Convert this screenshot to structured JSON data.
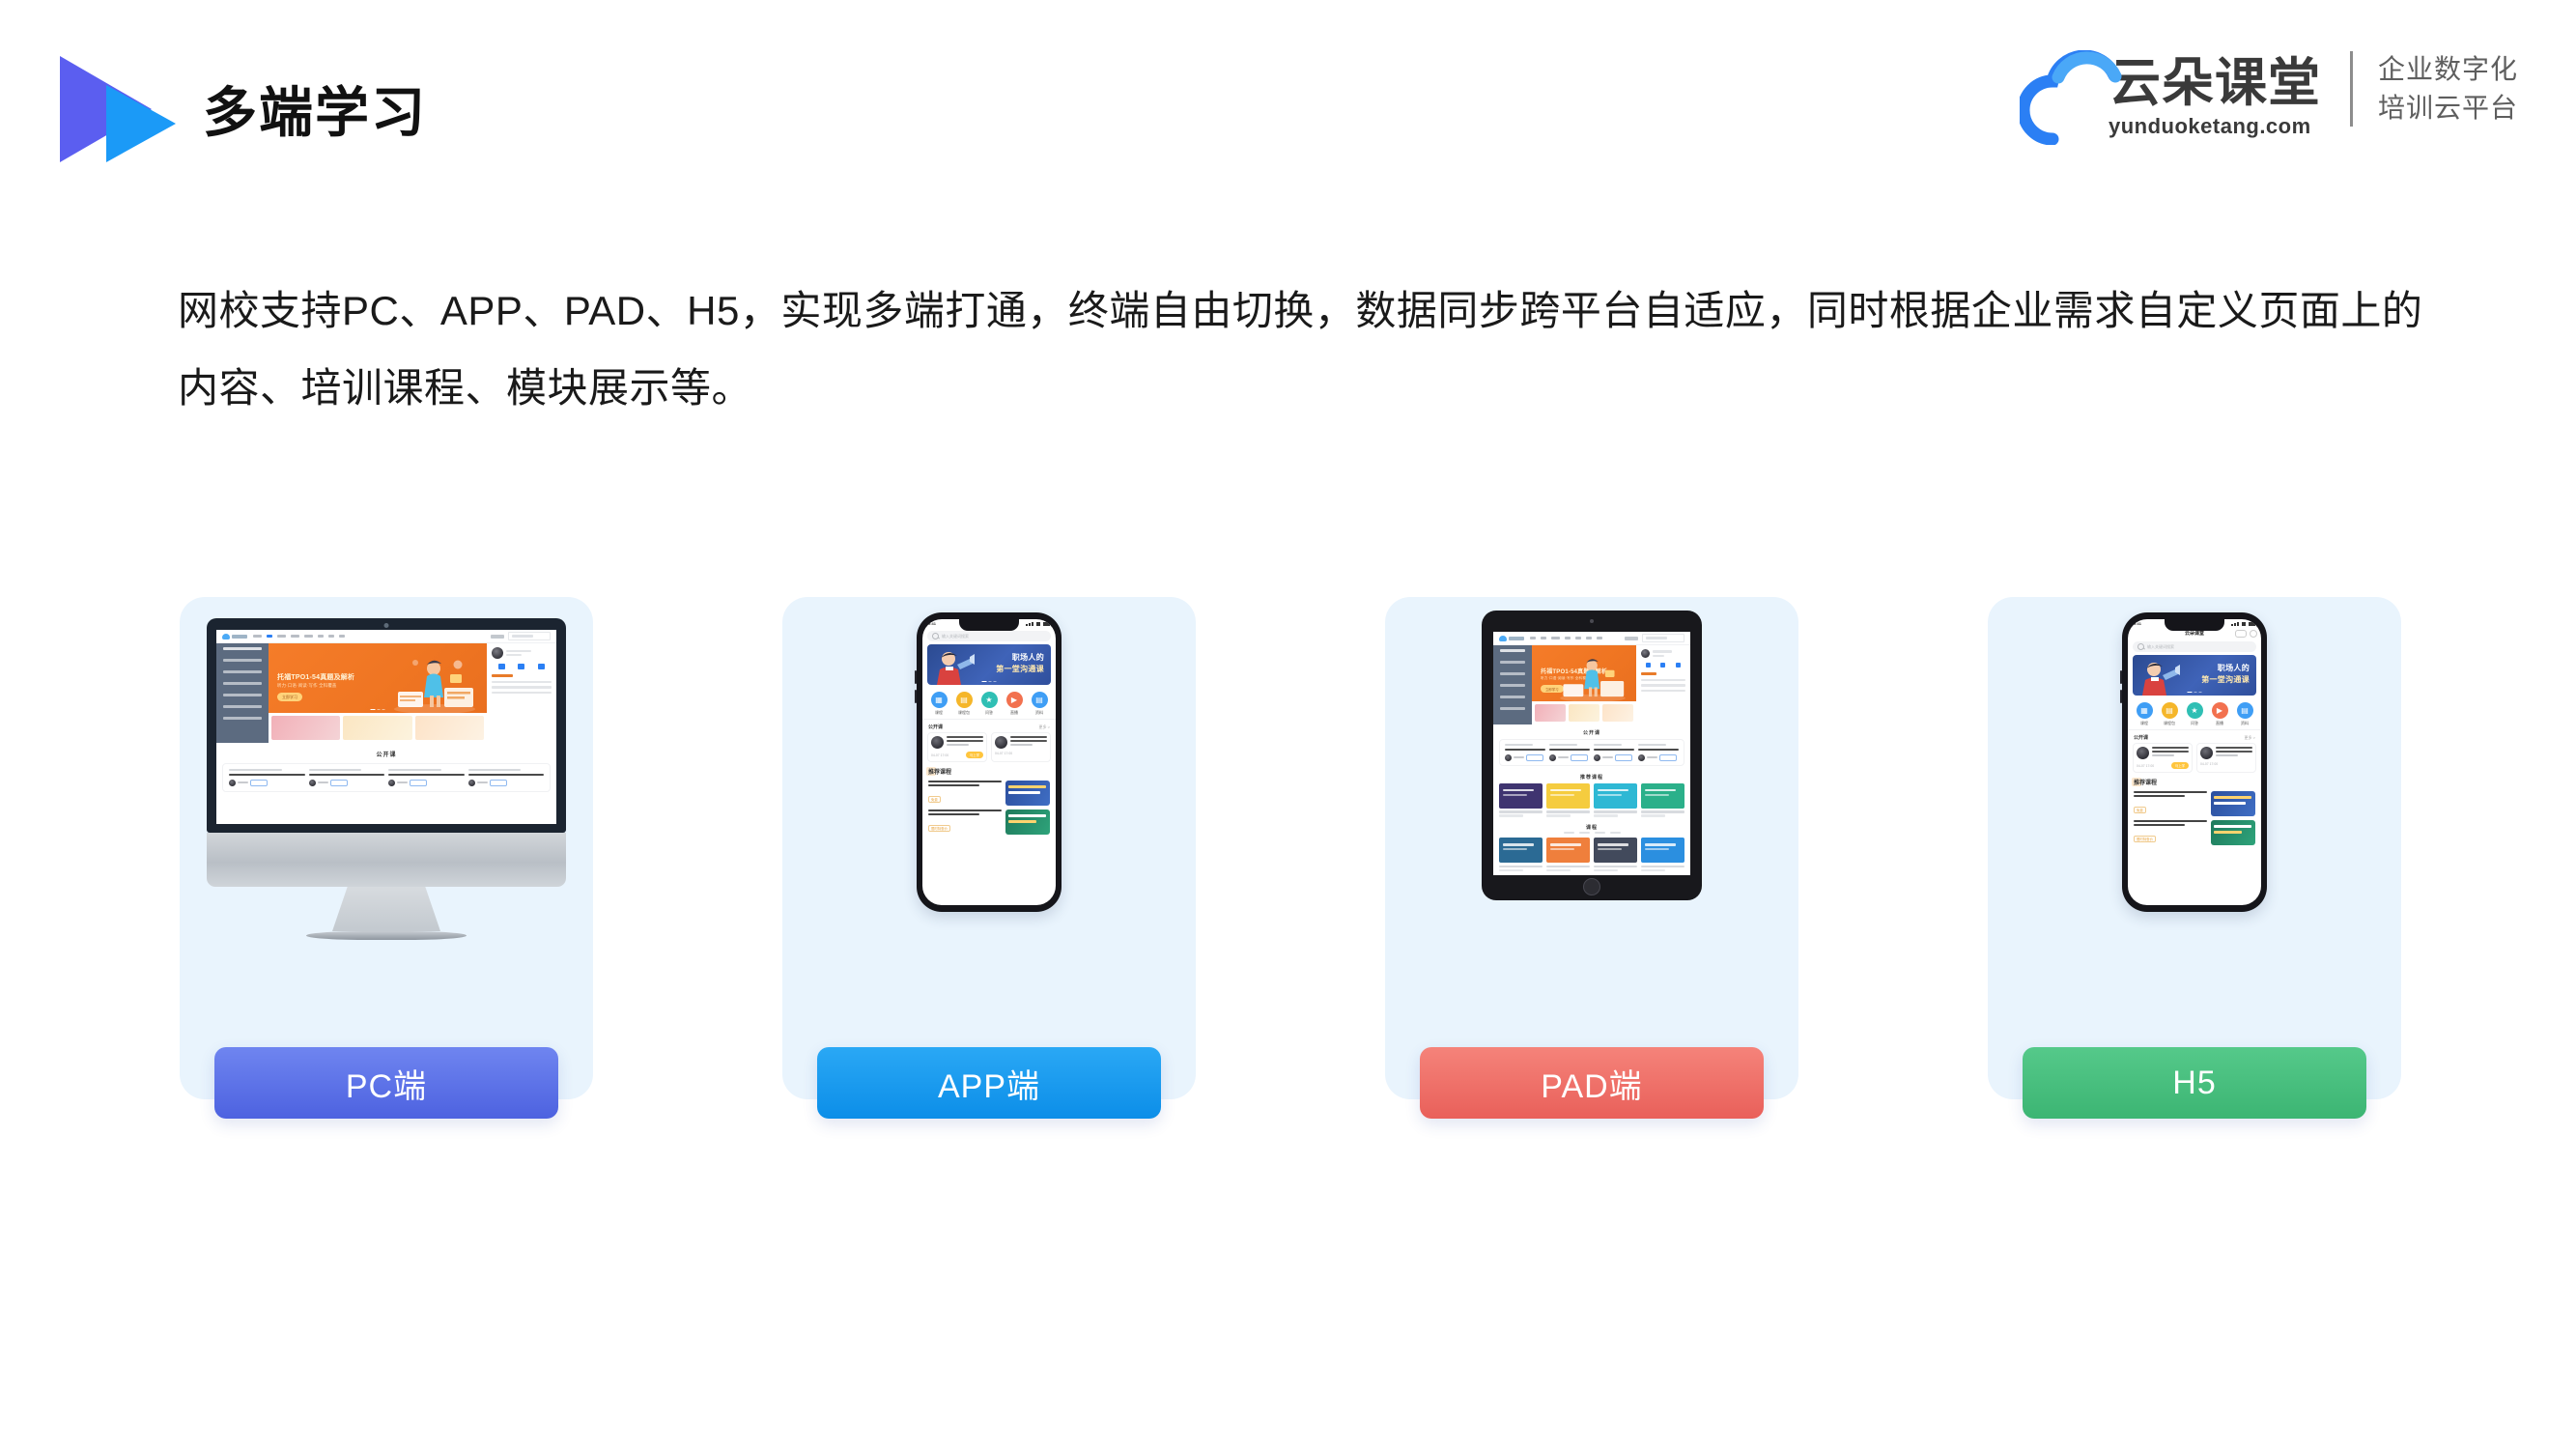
{
  "header": {
    "title": "多端学习",
    "logo_icon": "double-triangle-play-logo",
    "brand": {
      "cloud_icon": "cloud-icon",
      "name_cn": "云朵课堂",
      "url": "yunduoketang.com",
      "tagline_line1": "企业数字化",
      "tagline_line2": "培训云平台"
    }
  },
  "intro": {
    "paragraph": "网校支持PC、APP、PAD、H5，实现多端打通，终端自由切换，数据同步跨平台自适应，同时根据企业需求自定义页面上的内容、培训课程、模块展示等。"
  },
  "cards": [
    {
      "id": "pc",
      "button_label": "PC端",
      "button_color": "#4d62e0",
      "device": "imac-monitor",
      "screen": {
        "hero_title": "托福TPO1-54真题及解析",
        "hero_sub": "听力·口语·阅读·写作 全科覆盖",
        "hero_button": "立即学习",
        "section_title": "公开课"
      }
    },
    {
      "id": "app",
      "button_label": "APP端",
      "button_color": "#0c8ee8",
      "device": "iphone",
      "screen": {
        "status_time": "9:41",
        "search_placeholder": "输入关键词搜索",
        "banner_line1": "职场人的",
        "banner_line2": "第一堂沟通课",
        "categories": [
          "课程",
          "课程包",
          "问答",
          "直播",
          "资料"
        ],
        "category_colors": [
          "#3f9ef5",
          "#f5b62a",
          "#2fbfb4",
          "#f2714f",
          "#3f9ef5"
        ],
        "section_open": "公开课",
        "section_more": "更多 >",
        "course_title": "在老师的辅导下使用Axure进行交互原型设计",
        "course_meta": "主讲：yunduo",
        "course_time": "04-07 17:00",
        "course_tag": "马上学",
        "recommend_title": "推荐课程",
        "rec1_title": "PS海报配色讲解如何进行配色搭配技巧",
        "rec1_badge": "免费",
        "rec2_title": "在老师的辅导下用Axure进行交互原型实操练习",
        "rec2_badge": "限时特惠价"
      }
    },
    {
      "id": "pad",
      "button_label": "PAD端",
      "button_color": "#e9605a",
      "device": "ipad",
      "screen": {
        "hero_title": "托福TPO1-54真题及解析",
        "hero_sub": "听力·口语·阅读·写作 全科覆盖",
        "hero_button": "立即学习",
        "section_open": "公开课",
        "section_recommend": "推荐课程",
        "section_course": "课程",
        "tile_colors_row1": [
          "#3f3470",
          "#f5cc3f",
          "#2eb8d4",
          "#2bb08a"
        ],
        "tile_colors_row2": [
          "#2b6a94",
          "#ef7f3c",
          "#424a5c",
          "#2b8fe0"
        ],
        "tile_colors_row3": [
          "#f5cc3f",
          "#2b8fe0",
          "#2bb08a",
          "#ef7f3c"
        ]
      }
    },
    {
      "id": "h5",
      "button_label": "H5",
      "button_color": "#3cb573",
      "device": "iphone-h5",
      "screen": {
        "status_time": "9:41",
        "app_title": "云朵课堂",
        "search_placeholder": "输入关键词搜索",
        "banner_line1": "职场人的",
        "banner_line2": "第一堂沟通课",
        "categories": [
          "课程",
          "课程包",
          "问答",
          "直播",
          "资料"
        ],
        "category_colors": [
          "#3f9ef5",
          "#f5b62a",
          "#2fbfb4",
          "#f2714f",
          "#3f9ef5"
        ],
        "section_open": "公开课",
        "section_more": "更多 >",
        "course_title": "在老师的辅导下使用Axure进行交互原型设计",
        "course_time": "04-07 17:00",
        "course_tag": "马上学",
        "recommend_title": "推荐课程",
        "rec1_title": "PS海报配色讲解如何进行配色搭配技巧",
        "rec1_badge": "免费",
        "rec2_title": "在老师的辅导下用Axure进行交互原型实操练习",
        "rec2_badge": "限时特惠价"
      }
    }
  ]
}
